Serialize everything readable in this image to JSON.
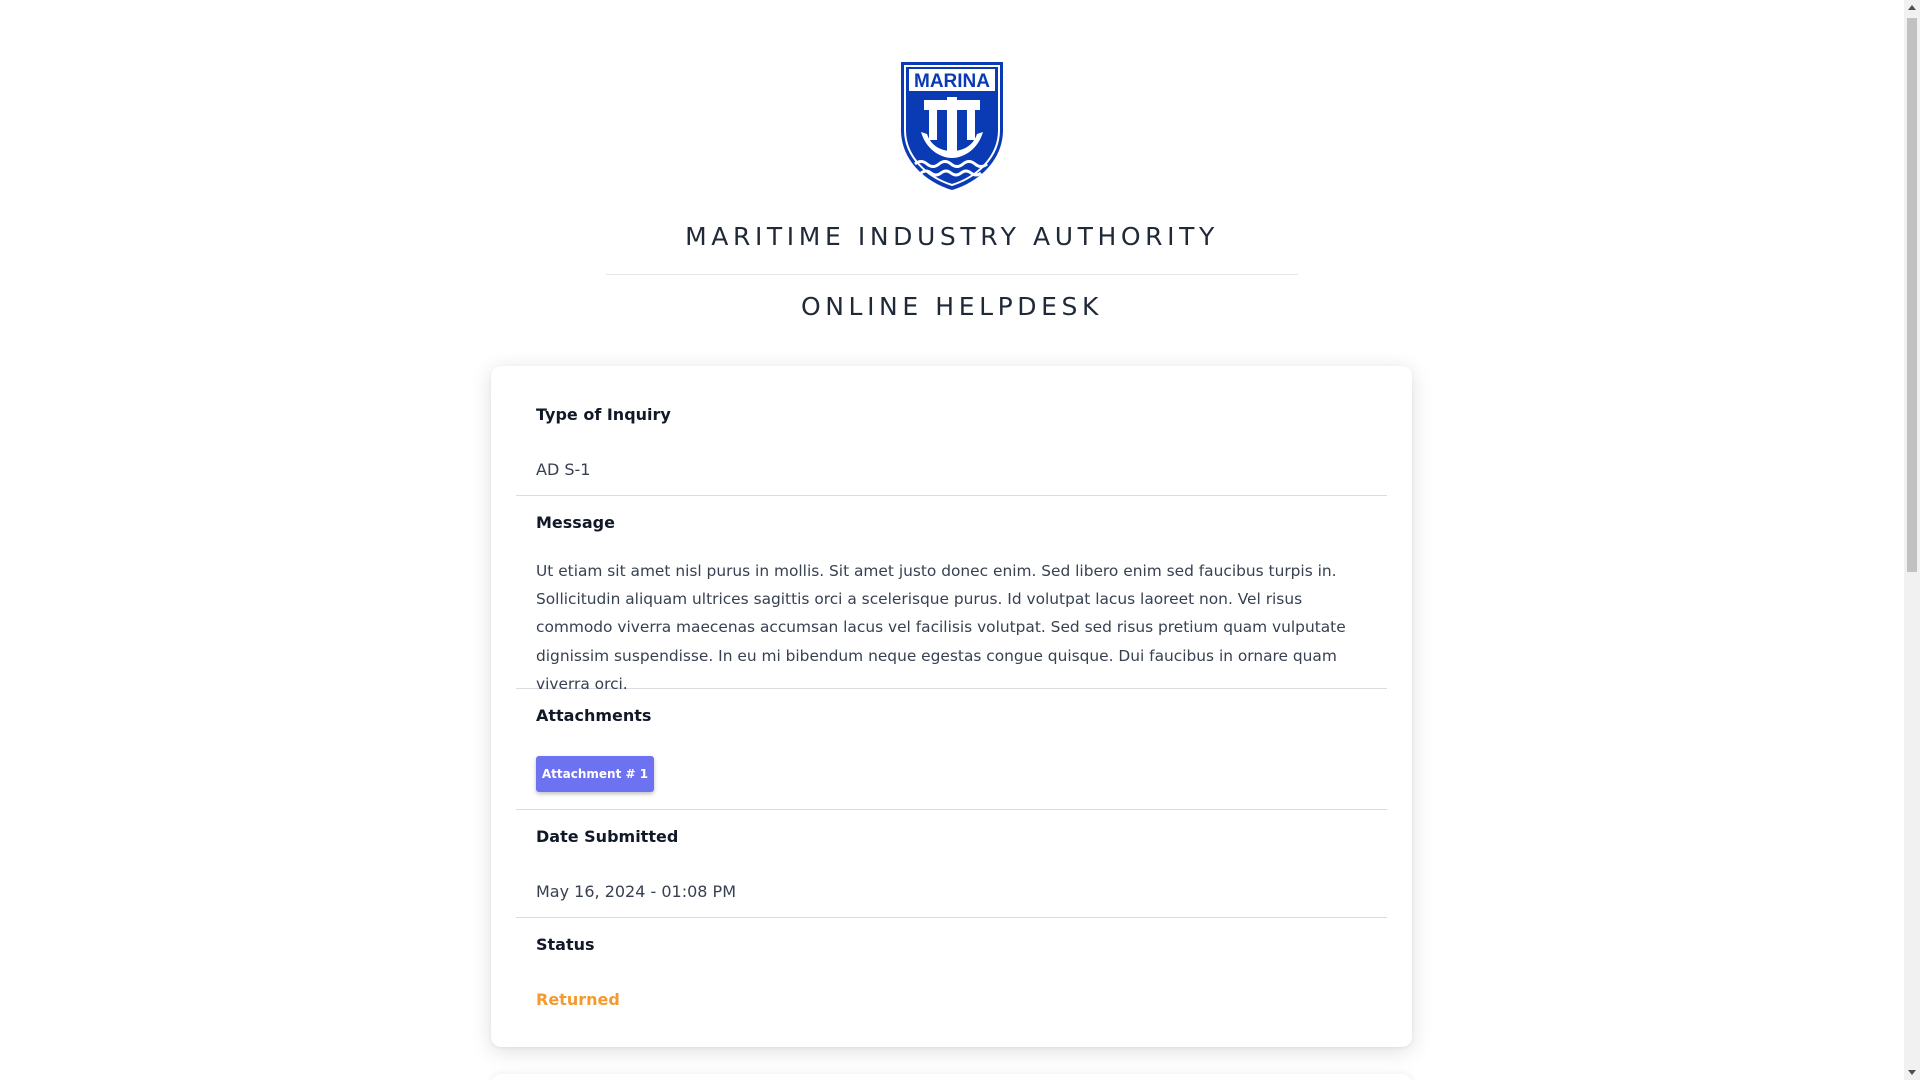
{
  "header": {
    "logo_text": "MARINA",
    "organization": "MARITIME INDUSTRY AUTHORITY",
    "title": "ONLINE HELPDESK",
    "brand_color": "#0a3bb5"
  },
  "inquiry": {
    "type_label": "Type of Inquiry",
    "type_value": "AD S-1",
    "message_label": "Message",
    "message_value": "Ut etiam sit amet nisl purus in mollis. Sit amet justo donec enim. Sed libero enim sed faucibus turpis in. Sollicitudin aliquam ultrices sagittis orci a scelerisque purus. Id volutpat lacus laoreet non. Vel risus commodo viverra maecenas accumsan lacus vel facilisis volutpat. Sed sed risus pretium quam vulputate dignissim suspendisse. In eu mi bibendum neque egestas congue quisque. Dui faucibus in ornare quam viverra orci.",
    "attachments_label": "Attachments",
    "attachments": [
      "Attachment # 1"
    ],
    "date_label": "Date Submitted",
    "date_value": "May 16, 2024 - 01:08 PM",
    "status_label": "Status",
    "status_value": "Returned",
    "status_color": "#f59a2c",
    "button_color": "#6d72f0"
  }
}
